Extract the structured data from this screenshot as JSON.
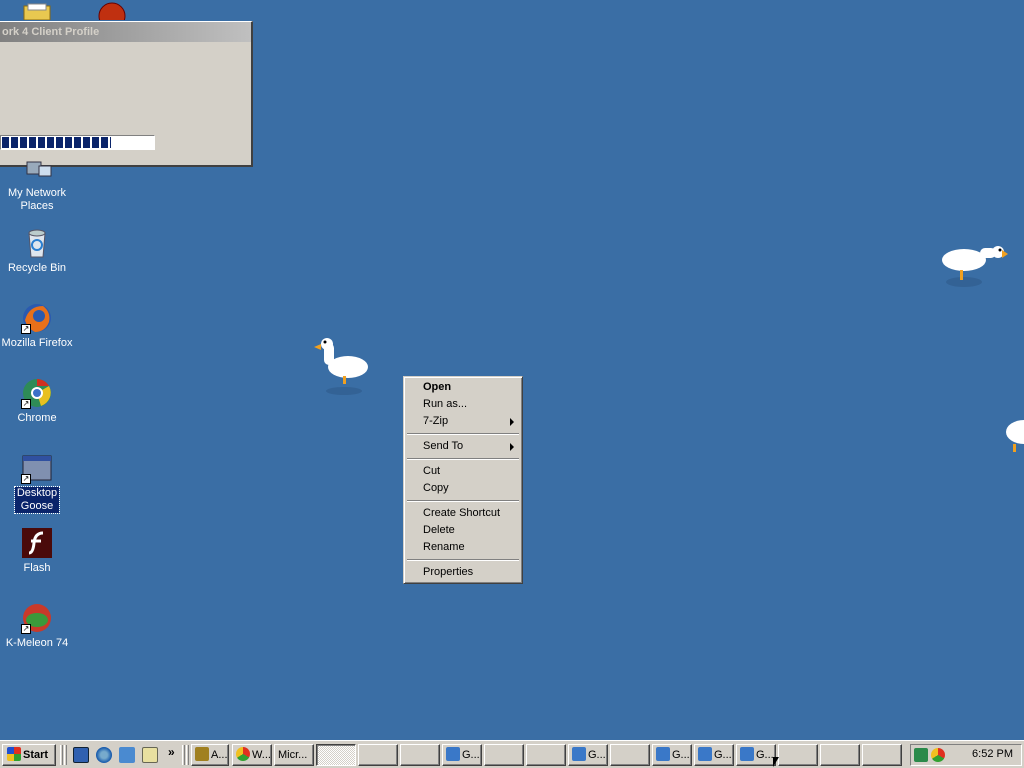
{
  "desktop": {
    "icons": [
      {
        "label": "My Network Places"
      },
      {
        "label": "Recycle Bin"
      },
      {
        "label": "Mozilla Firefox"
      },
      {
        "label": "Chrome"
      },
      {
        "label": "Desktop Goose"
      },
      {
        "label": "Flash"
      },
      {
        "label": "K-Meleon 74"
      }
    ]
  },
  "dialog": {
    "title": "ork 4 Client Profile",
    "progress_fraction": 0.72
  },
  "context_menu": {
    "items": [
      {
        "label": "Open"
      },
      {
        "label": "Run as..."
      },
      {
        "label": "7-Zip"
      },
      {
        "label": "Send To"
      },
      {
        "label": "Cut"
      },
      {
        "label": "Copy"
      },
      {
        "label": "Create Shortcut"
      },
      {
        "label": "Delete"
      },
      {
        "label": "Rename"
      },
      {
        "label": "Properties"
      }
    ]
  },
  "taskbar": {
    "start_label": "Start",
    "quicklaunch_more": "»",
    "buttons": [
      {
        "label": "A..."
      },
      {
        "label": "W..."
      },
      {
        "label": "Micr..."
      },
      {
        "label": ""
      },
      {
        "label": ""
      },
      {
        "label": ""
      },
      {
        "label": "G..."
      },
      {
        "label": ""
      },
      {
        "label": ""
      },
      {
        "label": "G..."
      },
      {
        "label": ""
      },
      {
        "label": "G..."
      },
      {
        "label": "G..."
      },
      {
        "label": "G..."
      },
      {
        "label": ""
      },
      {
        "label": ""
      },
      {
        "label": ""
      }
    ],
    "clock": "6:52 PM"
  },
  "colors": {
    "desktop": "#3a6ea5",
    "face": "#d4d0c8",
    "selection": "#0a246a"
  }
}
